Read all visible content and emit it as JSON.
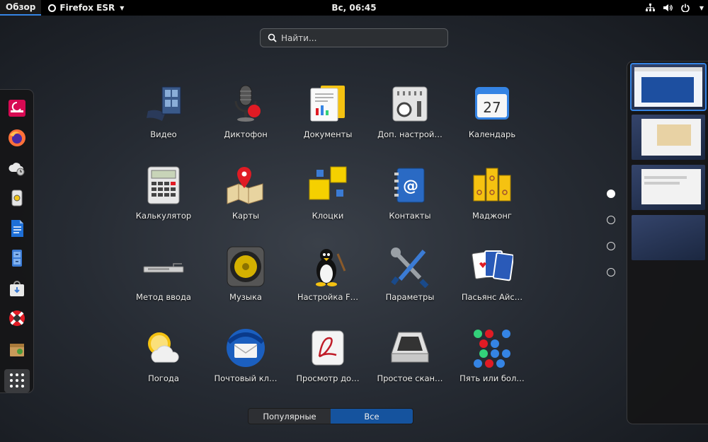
{
  "topbar": {
    "activities": "Обзор",
    "app_name": "Firefox ESR",
    "clock": "Вс, 06:45",
    "status_icons": [
      "network-icon",
      "volume-icon",
      "power-icon"
    ]
  },
  "search": {
    "placeholder": "Найти..."
  },
  "dash": {
    "items": [
      "debian-icon",
      "firefox-icon",
      "cloud-backup-icon",
      "sound-recorder-icon",
      "writer-icon",
      "file-cabinet-icon",
      "software-store-icon",
      "help-icon",
      "archive-icon"
    ],
    "show_apps": "show-apps-icon"
  },
  "apps": [
    {
      "label": "Видео",
      "icon": "video-icon"
    },
    {
      "label": "Диктофон",
      "icon": "microphone-icon"
    },
    {
      "label": "Документы",
      "icon": "documents-icon"
    },
    {
      "label": "Доп. настрой…",
      "icon": "tweaks-icon"
    },
    {
      "label": "Календарь",
      "icon": "calendar-icon"
    },
    {
      "label": "Калькулятор",
      "icon": "calculator-icon"
    },
    {
      "label": "Карты",
      "icon": "maps-icon"
    },
    {
      "label": "Клоцки",
      "icon": "klotski-icon"
    },
    {
      "label": "Контакты",
      "icon": "contacts-icon"
    },
    {
      "label": "Маджонг",
      "icon": "mahjongg-icon"
    },
    {
      "label": "Метод ввода",
      "icon": "keyboard-icon"
    },
    {
      "label": "Музыка",
      "icon": "music-speaker-icon"
    },
    {
      "label": "Настройка F…",
      "icon": "tux-icon"
    },
    {
      "label": "Параметры",
      "icon": "settings-tools-icon"
    },
    {
      "label": "Пасьянс Айс…",
      "icon": "cards-icon"
    },
    {
      "label": "Погода",
      "icon": "weather-icon"
    },
    {
      "label": "Почтовый кл…",
      "icon": "mail-client-icon"
    },
    {
      "label": "Просмотр до…",
      "icon": "document-viewer-icon"
    },
    {
      "label": "Простое скан…",
      "icon": "scanner-icon"
    },
    {
      "label": "Пять или бол…",
      "icon": "five-or-more-icon"
    }
  ],
  "calendar_day": "27",
  "pages": {
    "count": 4,
    "active": 1
  },
  "workspaces": {
    "count": 4,
    "active": 1
  },
  "toggle": {
    "frequent": "Популярные",
    "all": "Все",
    "selected": "all"
  },
  "colors": {
    "accent": "#3584e4",
    "selected": "#15539e",
    "topbar": "#000000"
  }
}
